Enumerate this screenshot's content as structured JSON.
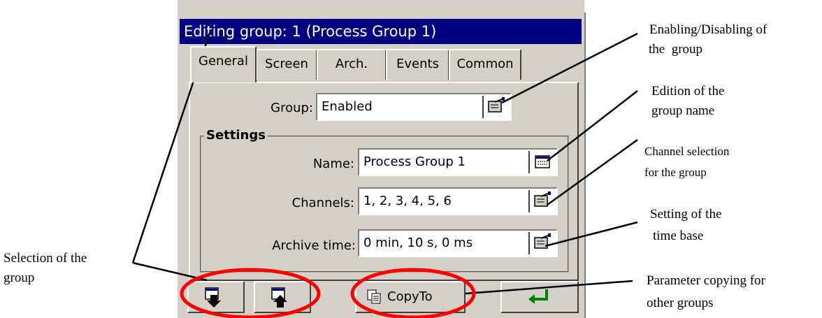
{
  "window": {
    "title": "Editing group: 1 (Process Group 1)"
  },
  "tabs": [
    {
      "label": "General",
      "active": true
    },
    {
      "label": "Screen",
      "active": false
    },
    {
      "label": "Arch.",
      "active": false
    },
    {
      "label": "Events",
      "active": false
    },
    {
      "label": "Common",
      "active": false
    }
  ],
  "general": {
    "group_label": "Group:",
    "group_value": "Enabled",
    "settings_title": "Settings",
    "name_label": "Name:",
    "name_value": "Process Group 1",
    "channels_label": "Channels:",
    "channels_value": "1, 2, 3, 4, 5, 6",
    "archive_label": "Archive time:",
    "archive_value": "0 min, 10 s, 0 ms"
  },
  "buttons": {
    "copy_label": "CopyTo"
  },
  "annotations": {
    "enabling_1": "Enabling/Disabling of",
    "enabling_2": "the  group",
    "edition_1": "Edition of the",
    "edition_2": "group name",
    "channel_1": "Channel selection",
    "channel_2": "for the group",
    "setting_1": "Setting of the",
    "setting_2": "time base",
    "copy_1": "Parameter copying for",
    "copy_2": "other groups",
    "selection_1": "Selection of the",
    "selection_2": "group"
  },
  "colors": {
    "titlebar": "#000080",
    "highlight": "#ff0000",
    "dialog": "#d4d0c8",
    "enter_arrow": "#008000"
  },
  "icons": [
    "edit-properties-icon",
    "keyboard-icon",
    "next-group-icon",
    "previous-group-icon",
    "copy-icon",
    "enter-arrow-icon"
  ]
}
